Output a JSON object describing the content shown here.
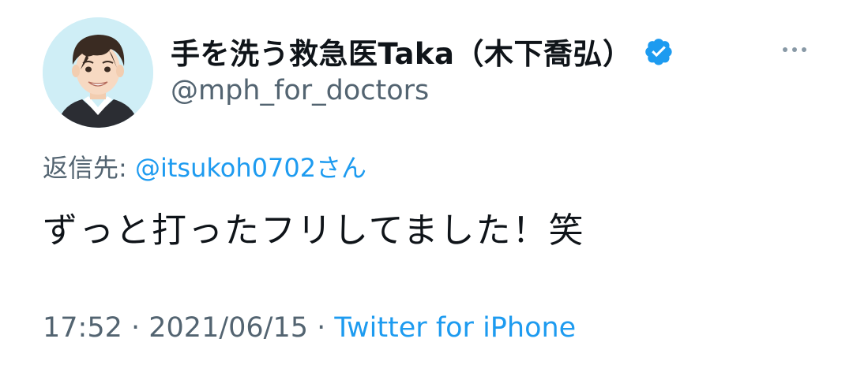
{
  "tweet": {
    "display_name": "手を洗う救急医Taka（木下喬弘）",
    "handle": "@mph_for_doctors",
    "verified_icon": "verified-badge-icon",
    "more_icon": "more-options-icon",
    "avatar": "user-avatar-illustration",
    "reply": {
      "label": "返信先: ",
      "user": "@itsukoh0702さん"
    },
    "text": "ずっと打ったフリしてました！笑",
    "meta": {
      "time": "17:52",
      "sep1": " · ",
      "date": "2021/06/15",
      "sep2": " · ",
      "source": "Twitter for iPhone"
    }
  },
  "colors": {
    "text_primary": "#0f1419",
    "text_secondary": "#536471",
    "link": "#1d9bf0",
    "avatar_bg": "#cfeef6"
  }
}
